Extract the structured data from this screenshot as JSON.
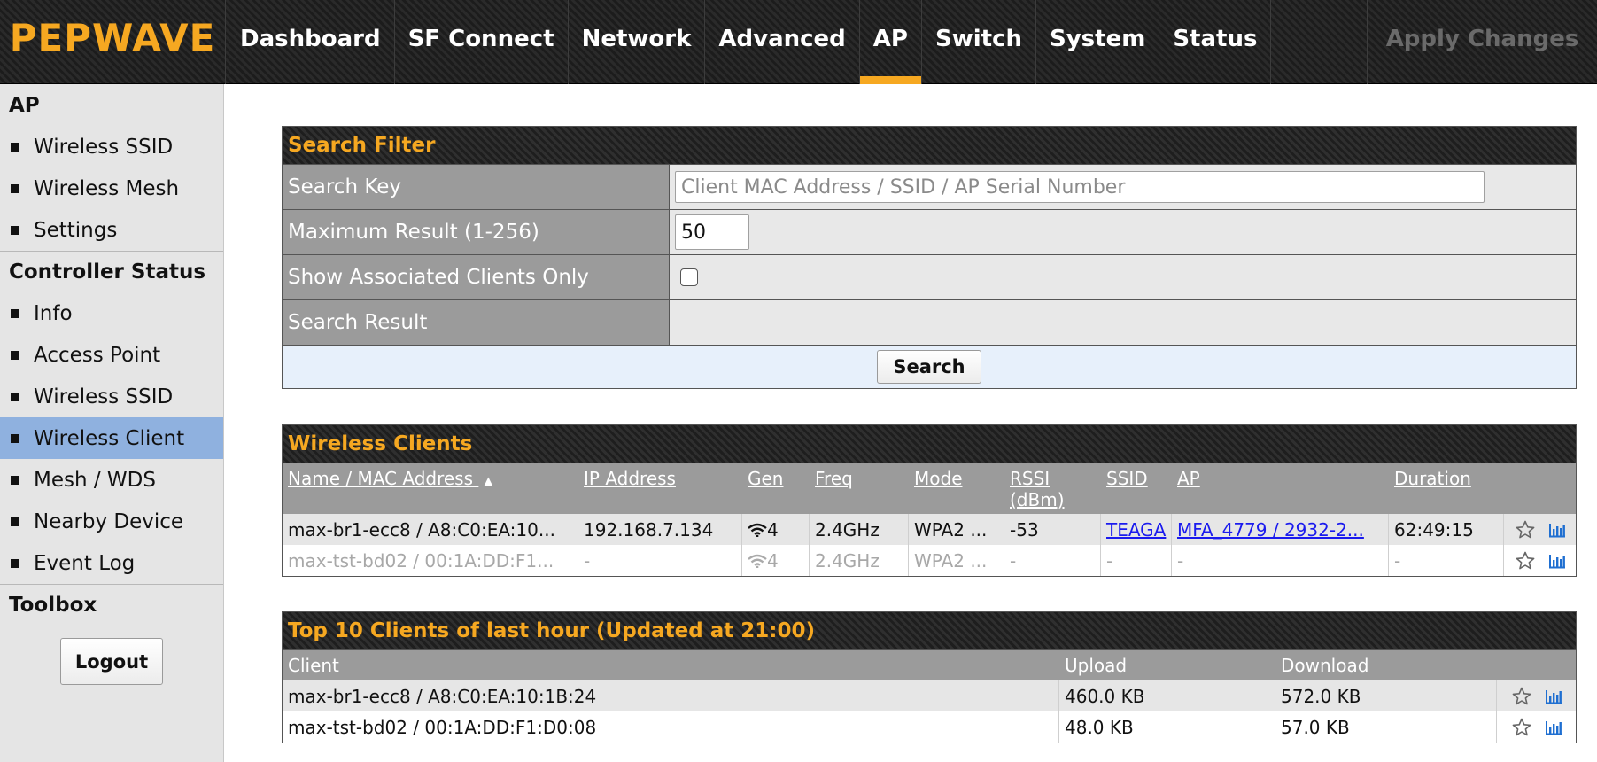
{
  "brand": {
    "logo_text": "PEPWAVE",
    "accent_color": "#f6a821",
    "active_side_color": "#8fb1df"
  },
  "nav": {
    "items": [
      "Dashboard",
      "SF Connect",
      "Network",
      "Advanced",
      "AP",
      "Switch",
      "System",
      "Status"
    ],
    "active": "AP",
    "apply_label": "Apply Changes"
  },
  "sidebar": {
    "section_ap": "AP",
    "ap_items": [
      "Wireless SSID",
      "Wireless Mesh",
      "Settings"
    ],
    "section_controller": "Controller Status",
    "controller_items": [
      "Info",
      "Access Point",
      "Wireless SSID",
      "Wireless Client",
      "Mesh / WDS",
      "Nearby Device",
      "Event Log"
    ],
    "active_item": "Wireless Client",
    "section_toolbox": "Toolbox",
    "logout_label": "Logout"
  },
  "search_filter": {
    "title": "Search Filter",
    "search_key_label": "Search Key",
    "search_key_placeholder": "Client MAC Address / SSID / AP Serial Number",
    "search_key_value": "",
    "max_result_label": "Maximum Result (1-256)",
    "max_result_value": "50",
    "assoc_only_label": "Show Associated Clients Only",
    "assoc_only_checked": false,
    "search_result_label": "Search Result",
    "search_result_value": "",
    "search_button": "Search"
  },
  "wireless_clients": {
    "title": "Wireless Clients",
    "columns": {
      "name": "Name / MAC Address",
      "sort_indicator": "▲",
      "ip": "IP Address",
      "gen": "Gen",
      "freq": "Freq",
      "mode": "Mode",
      "rssi": "RSSI (dBm)",
      "ssid": "SSID",
      "ap": "AP",
      "duration": "Duration"
    },
    "rows": [
      {
        "name": "max-br1-ecc8 / A8:C0:EA:10...",
        "ip": "192.168.7.134",
        "gen": "4",
        "freq": "2.4GHz",
        "mode": "WPA2 ...",
        "rssi": "-53",
        "ssid": "TEAGA",
        "ap": "MFA_4779 / 2932-2...",
        "duration": "62:49:15"
      },
      {
        "name": "max-tst-bd02 / 00:1A:DD:F1...",
        "ip": "-",
        "gen": "4",
        "freq": "2.4GHz",
        "mode": "WPA2 ...",
        "rssi": "-",
        "ssid": "-",
        "ap": "-",
        "duration": "-"
      }
    ]
  },
  "top_clients": {
    "title": "Top 10 Clients of last hour (Updated at 21:00)",
    "columns": {
      "client": "Client",
      "upload": "Upload",
      "download": "Download"
    },
    "rows": [
      {
        "client": "max-br1-ecc8 / A8:C0:EA:10:1B:24",
        "upload": "460.0 KB",
        "download": "572.0 KB"
      },
      {
        "client": "max-tst-bd02 / 00:1A:DD:F1:D0:08",
        "upload": "48.0 KB",
        "download": "57.0 KB"
      }
    ]
  },
  "icons": {
    "favorite": "star-icon",
    "usage": "bar-chart-icon",
    "signal": "wifi-signal-icon",
    "sort": "sort-asc-icon"
  }
}
